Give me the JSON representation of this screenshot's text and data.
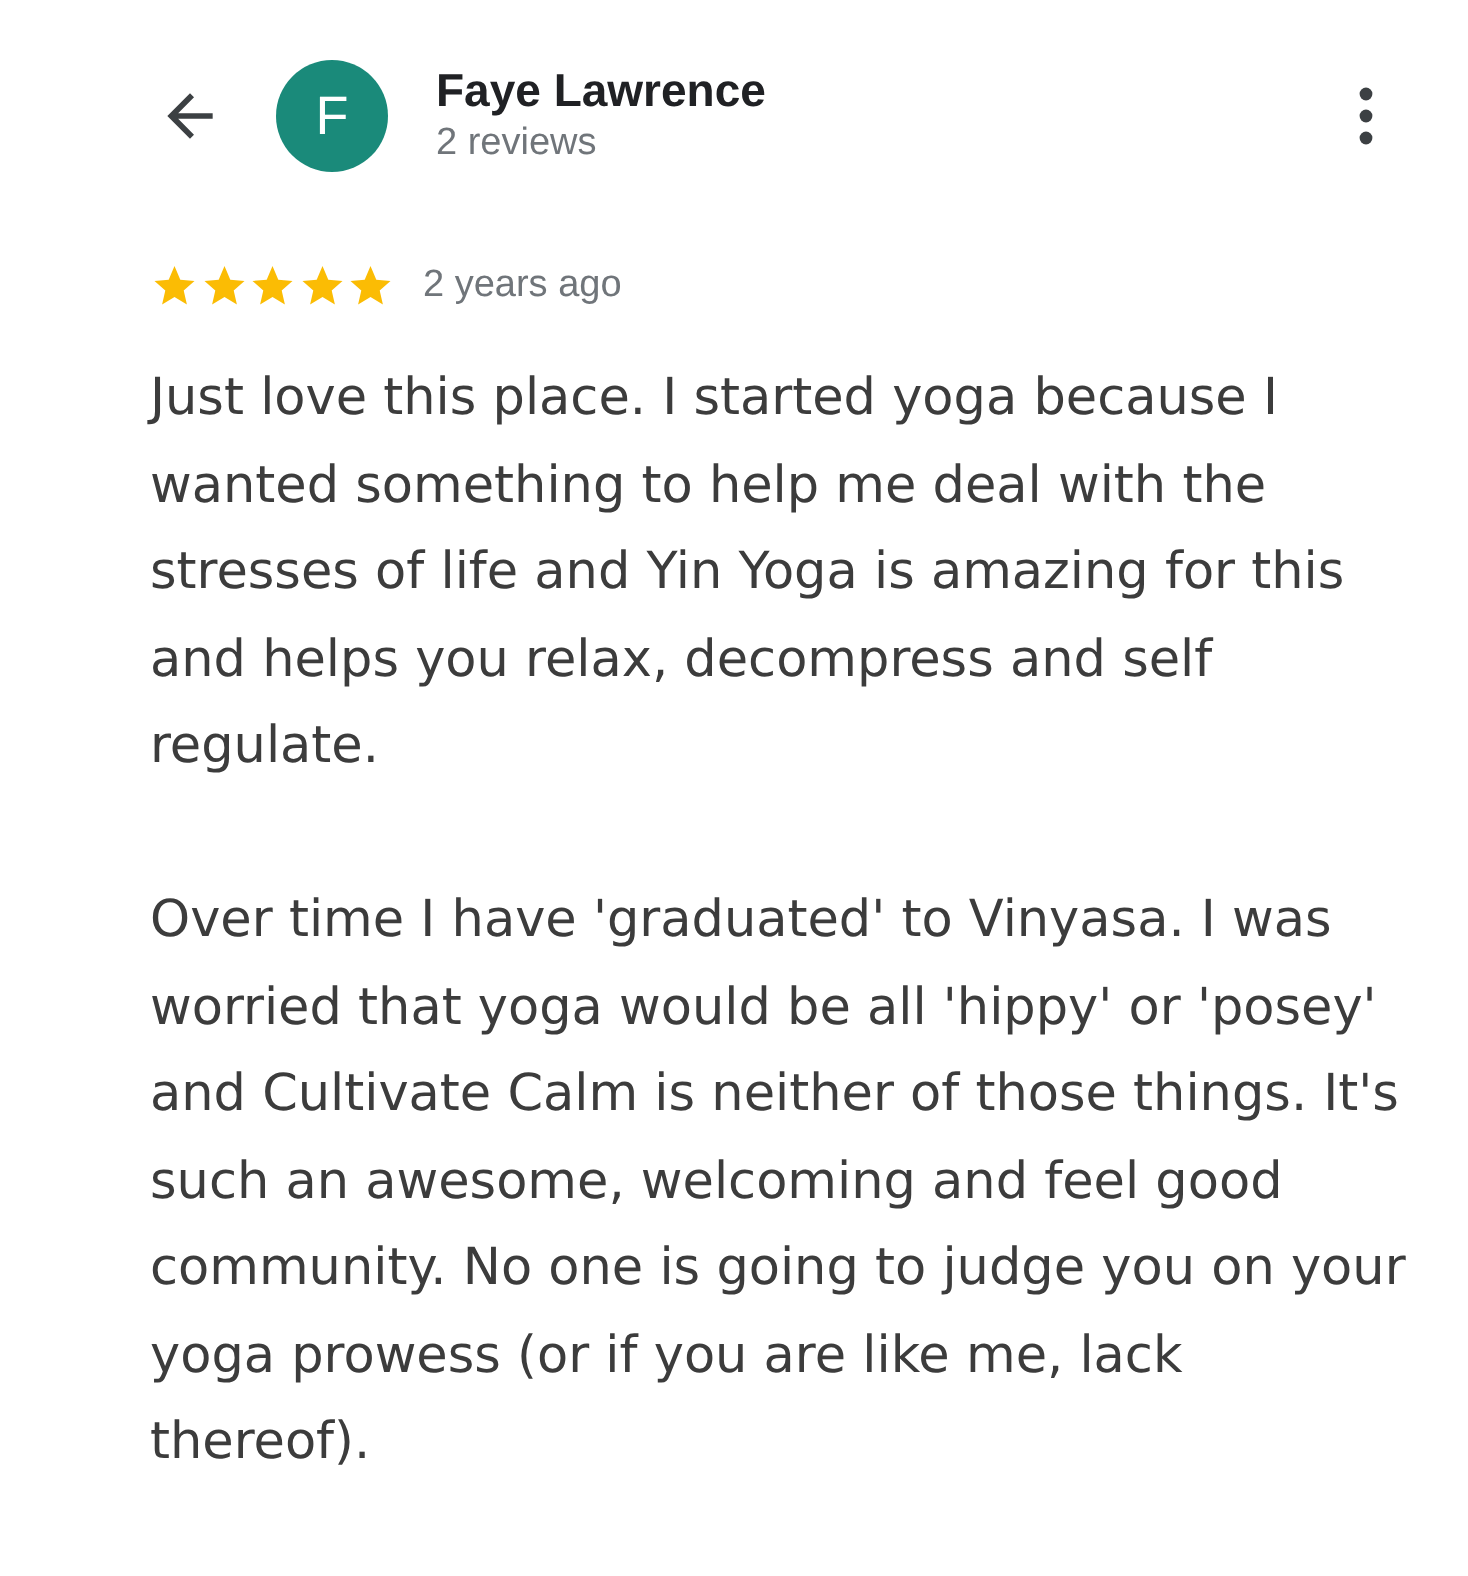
{
  "header": {
    "avatar_letter": "F",
    "name": "Faye Lawrence",
    "subtitle": "2 reviews"
  },
  "review": {
    "stars": 5,
    "time": "2 years ago",
    "paragraphs": [
      "Just love this place. I started yoga because I wanted something to help me deal with the stresses of life and Yin Yoga is amazing for this and helps you relax, decompress and self regulate.",
      "Over time I have 'graduated' to Vinyasa. I was worried that yoga would be all 'hippy' or 'posey' and Cultivate Calm is neither of those things. It's such an awesome, welcoming and feel good community. No one is going to judge you on your yoga prowess (or if you are like me, lack thereof)."
    ]
  }
}
